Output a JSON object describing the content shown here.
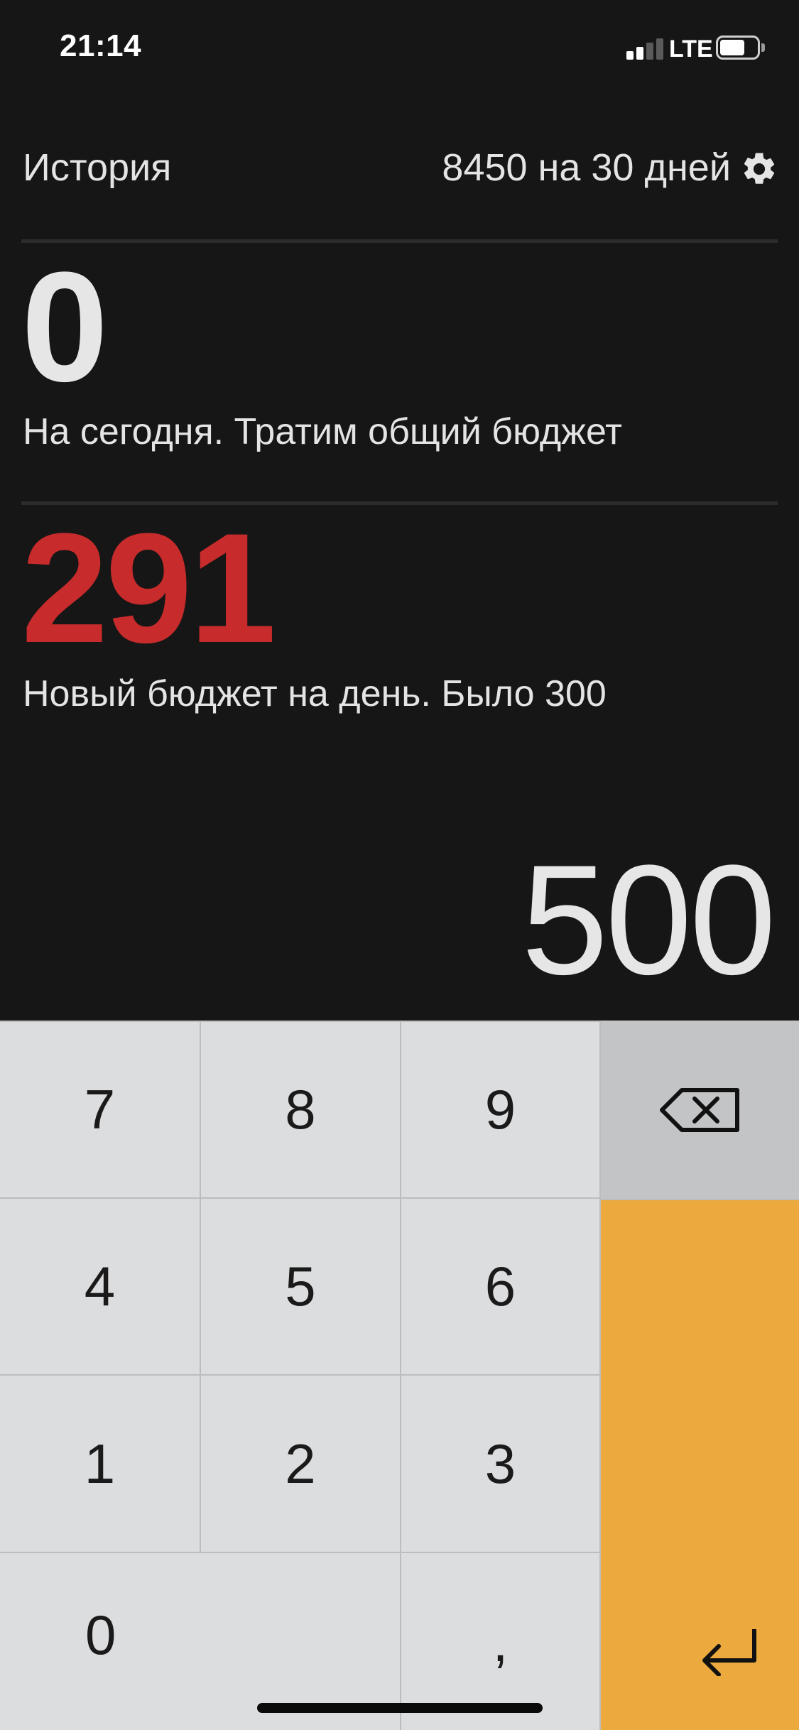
{
  "status_bar": {
    "time": "21:14",
    "network": "LTE"
  },
  "header": {
    "history_label": "История",
    "budget_label": "8450 на 30 дней"
  },
  "today": {
    "amount": "0",
    "caption": "На сегодня. Тратим общий бюджет"
  },
  "daily": {
    "amount": "291",
    "caption": "Новый бюджет на день. Было 300",
    "amount_color": "#c72b2b"
  },
  "input": {
    "amount": "500"
  },
  "keypad": {
    "keys": {
      "k7": "7",
      "k8": "8",
      "k9": "9",
      "k4": "4",
      "k5": "5",
      "k6": "6",
      "k1": "1",
      "k2": "2",
      "k3": "3",
      "k0": "0",
      "comma": ","
    },
    "backspace_icon": "backspace-icon",
    "enter_icon": "return-icon",
    "enter_color": "#ecaa3e"
  }
}
